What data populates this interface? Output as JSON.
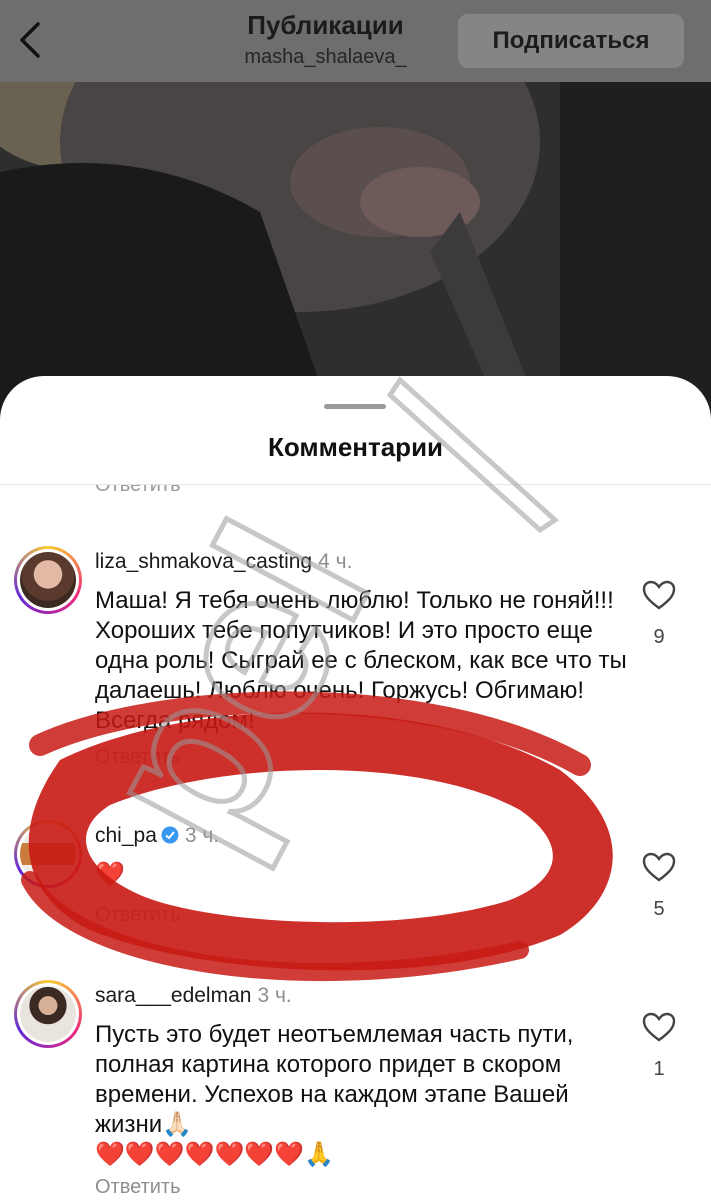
{
  "header": {
    "title": "Публикации",
    "subtitle": "masha_shalaeva_",
    "follow_label": "Подписаться"
  },
  "sheet": {
    "title": "Комментарии",
    "partial_reply": "Ответить"
  },
  "comments": [
    {
      "username": "liza_shmakova_casting",
      "time": "4 ч.",
      "text": "Маша! Я тебя очень люблю! Только не гоняй!!! Хороших тебе попутчиков! И это просто еще одна роль! Сыграй ее с блеском, как все что ты далаешь! Люблю очень! Горжусь! Обгимаю! Всегда рядом!",
      "reply": "Ответить",
      "likes": "9"
    },
    {
      "username": "chi_pa",
      "time": "3 ч.",
      "text": "❤️",
      "reply": "Ответить",
      "likes": "5",
      "verified": true
    },
    {
      "username": "sara___edelman",
      "time": "3 ч.",
      "text": "Пусть это будет неотъемлемая часть пути, полная картина которого придет в скором времени. Успехов на каждом этапе Вашей жизни🙏🏻",
      "text_emoji": "❤️❤️❤️❤️❤️❤️❤️🙏",
      "reply": "Ответить",
      "likes": "1"
    }
  ],
  "watermark_text": "pel",
  "colors": {
    "scribble": "#c81a14",
    "verified": "#3897f0",
    "topbar": "#6e6e6e"
  }
}
